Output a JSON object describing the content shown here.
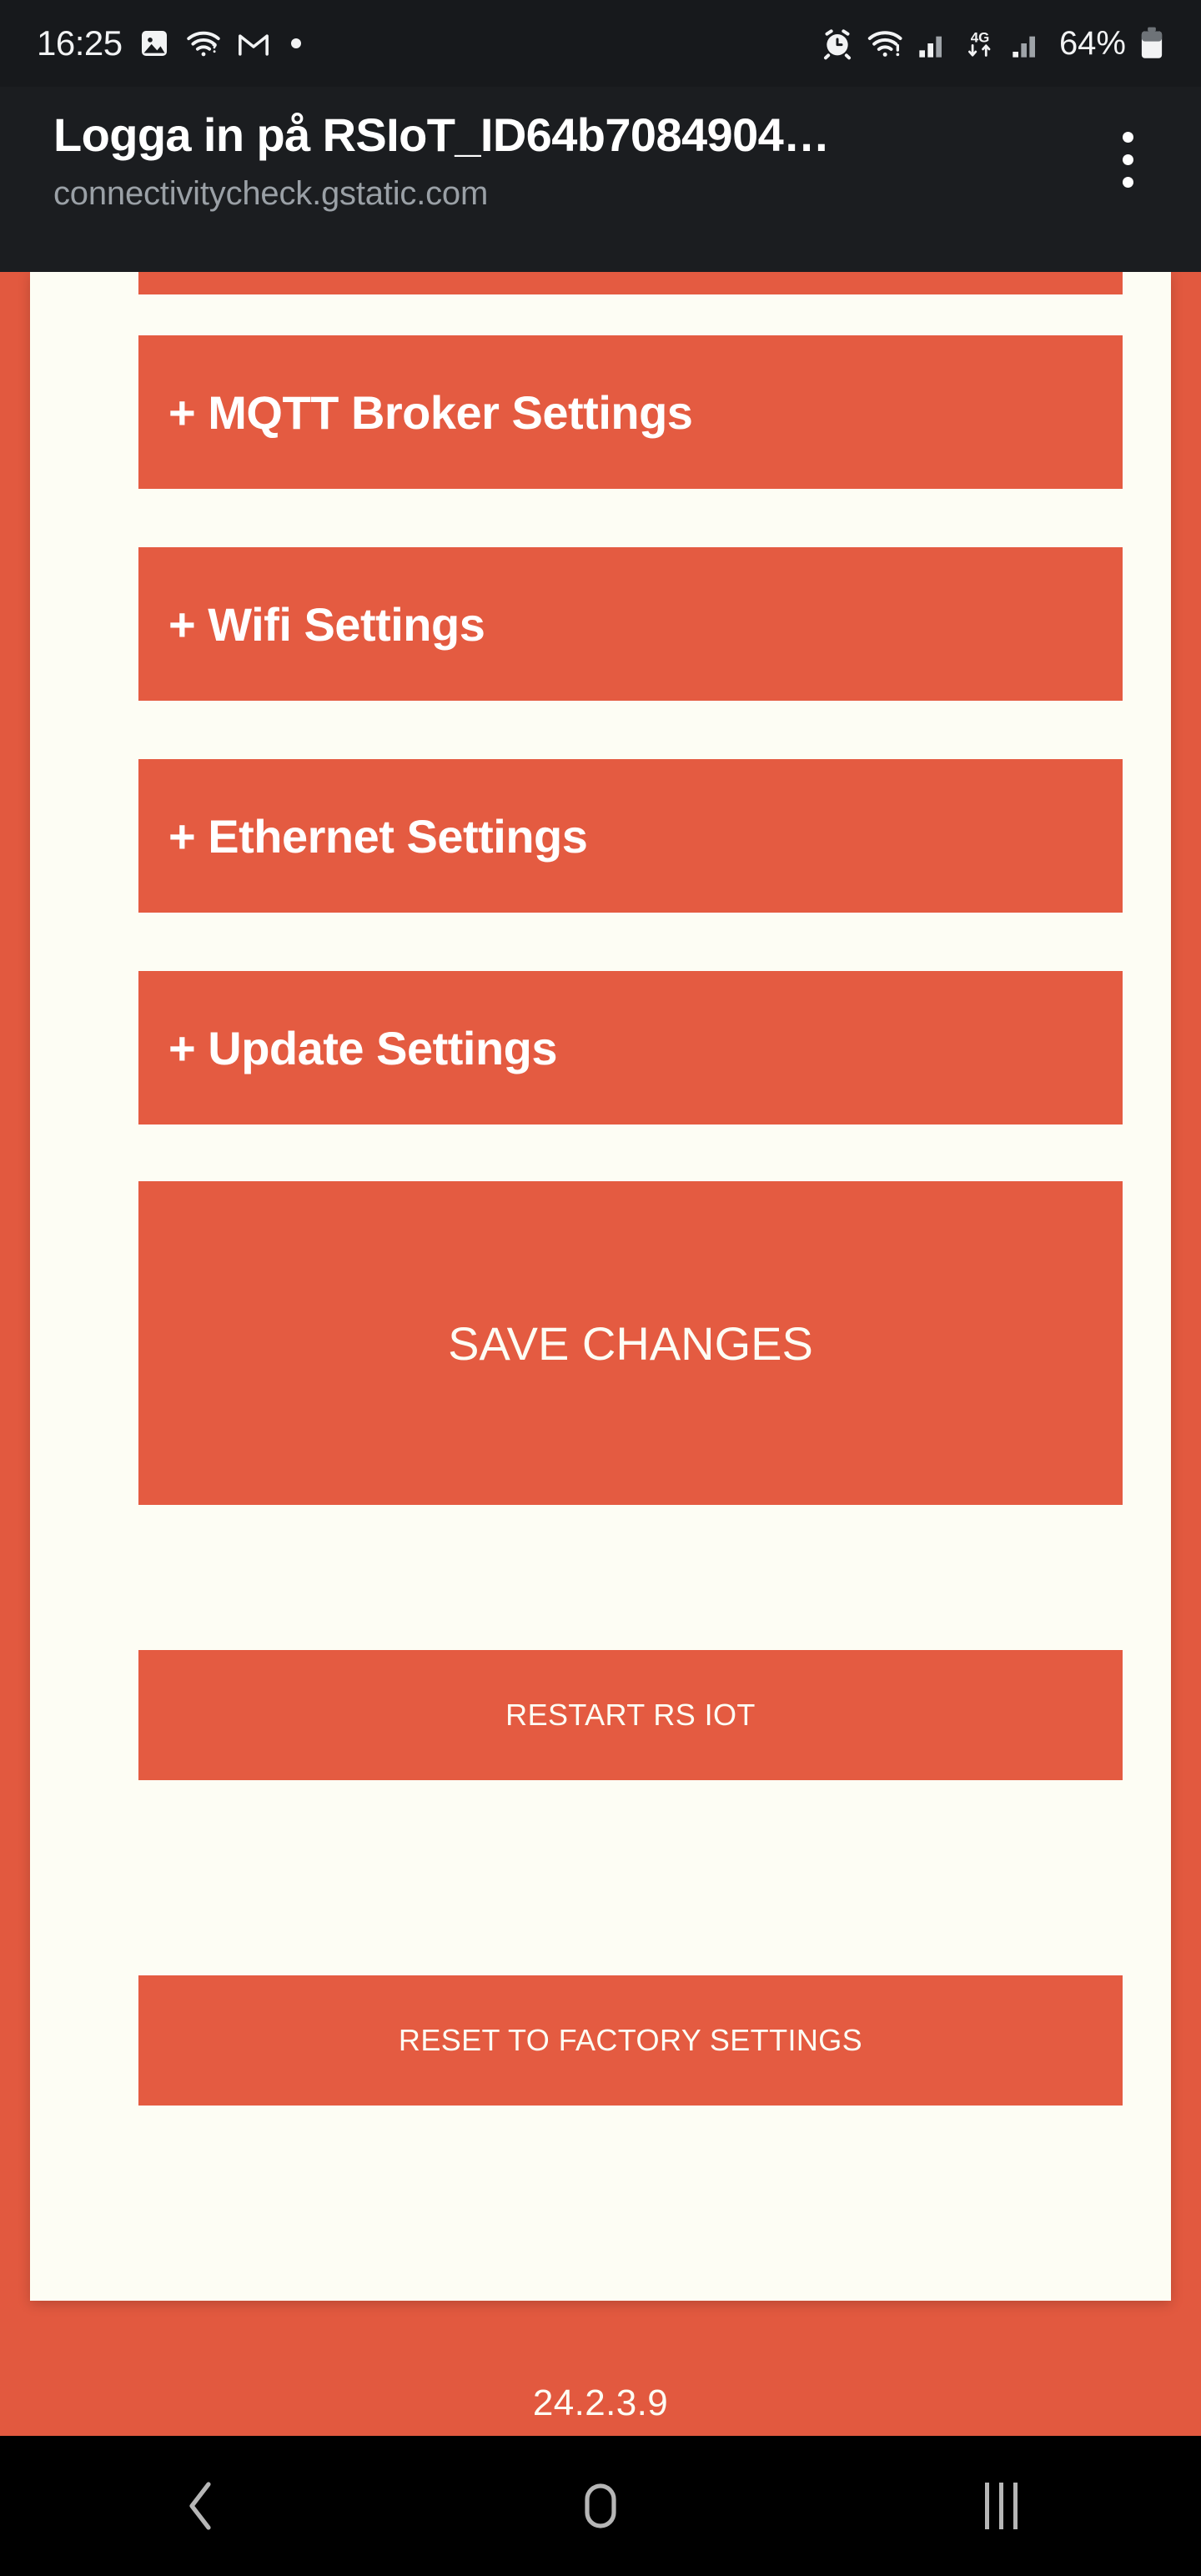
{
  "status_bar": {
    "clock": "16:25",
    "battery_percent": "64%",
    "network_type": "4G",
    "left_icons": [
      "screenshot-icon",
      "wifi-question-icon",
      "gmail-icon",
      "more-dot-icon"
    ],
    "right_icons": [
      "alarm-icon",
      "wifi-alert-icon",
      "signal-bars-icon",
      "4g-data-icon",
      "signal-bars-2-icon",
      "battery-icon"
    ],
    "colors": {
      "background": "#17191C",
      "foreground": "#F2F3F4"
    }
  },
  "browser": {
    "title": "Logga in på RSIoT_ID64b7084904…",
    "url": "connectivitycheck.gstatic.com",
    "overflow_menu": "overflow-menu-icon",
    "colors": {
      "background": "#1B1D20",
      "title": "#FFFFFF",
      "url": "#9AA0A6"
    }
  },
  "page": {
    "theme": {
      "accent": "#E45B41",
      "page_background": "#E2593F",
      "card_background": "#FDFDF4",
      "button_text": "#FDFDF4"
    },
    "sections": [
      {
        "label": "+ MQTT Broker Settings",
        "name": "mqtt-broker-settings-section"
      },
      {
        "label": "+ Wifi Settings",
        "name": "wifi-settings-section"
      },
      {
        "label": "+ Ethernet Settings",
        "name": "ethernet-settings-section"
      },
      {
        "label": "+ Update Settings",
        "name": "update-settings-section"
      }
    ],
    "actions": {
      "save": "SAVE CHANGES",
      "restart": "RESTART RS IOT",
      "reset": "RESET TO FACTORY SETTINGS"
    },
    "version": "24.2.3.9"
  },
  "nav_bar": {
    "back": "back-icon",
    "home": "home-icon",
    "recents": "recents-icon"
  }
}
